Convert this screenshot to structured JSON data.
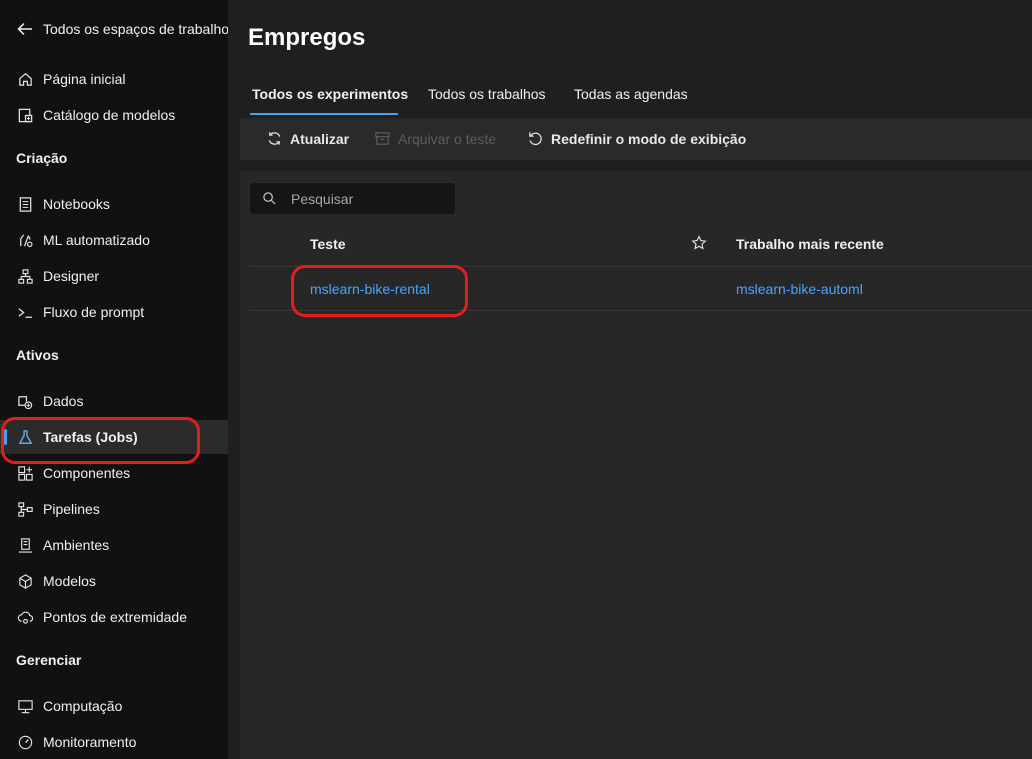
{
  "sidebar": {
    "back_label": "Todos os espaços de trabalho",
    "items": [
      {
        "label": "Página inicial",
        "icon": "home-icon"
      },
      {
        "label": "Catálogo de modelos",
        "icon": "model-catalog-icon"
      },
      {
        "label": "Notebooks",
        "icon": "notebook-icon"
      },
      {
        "label": "ML automatizado",
        "icon": "automl-icon"
      },
      {
        "label": "Designer",
        "icon": "designer-icon"
      },
      {
        "label": "Fluxo de prompt",
        "icon": "prompt-flow-icon"
      },
      {
        "label": "Dados",
        "icon": "data-icon"
      },
      {
        "label": "Tarefas (Jobs)",
        "icon": "flask-icon",
        "active": true
      },
      {
        "label": "Componentes",
        "icon": "components-icon"
      },
      {
        "label": "Pipelines",
        "icon": "pipelines-icon"
      },
      {
        "label": "Ambientes",
        "icon": "environments-icon"
      },
      {
        "label": "Modelos",
        "icon": "cube-icon"
      },
      {
        "label": "Pontos de extremidade",
        "icon": "endpoint-icon"
      },
      {
        "label": "Computação",
        "icon": "compute-icon"
      },
      {
        "label": "Monitoramento",
        "icon": "monitoring-icon"
      }
    ],
    "sections": {
      "criacao": "Criação",
      "ativos": "Ativos",
      "gerenciar": "Gerenciar"
    }
  },
  "main": {
    "title": "Empregos",
    "tabs": [
      {
        "label": "Todos os experimentos",
        "active": true
      },
      {
        "label": "Todos os trabalhos"
      },
      {
        "label": "Todas as agendas"
      }
    ],
    "toolbar": {
      "refresh": "Atualizar",
      "archive": "Arquivar o teste",
      "reset_view": "Redefinir o modo de exibição"
    },
    "search_placeholder": "Pesquisar",
    "table": {
      "columns": [
        "Teste",
        "Trabalho mais recente"
      ],
      "rows": [
        {
          "experiment": "mslearn-bike-rental",
          "latest_job": "mslearn-bike-automl"
        }
      ]
    }
  },
  "colors": {
    "accent": "#4aa0f0",
    "link": "#4aa3ff",
    "highlight": "#e0201b"
  }
}
